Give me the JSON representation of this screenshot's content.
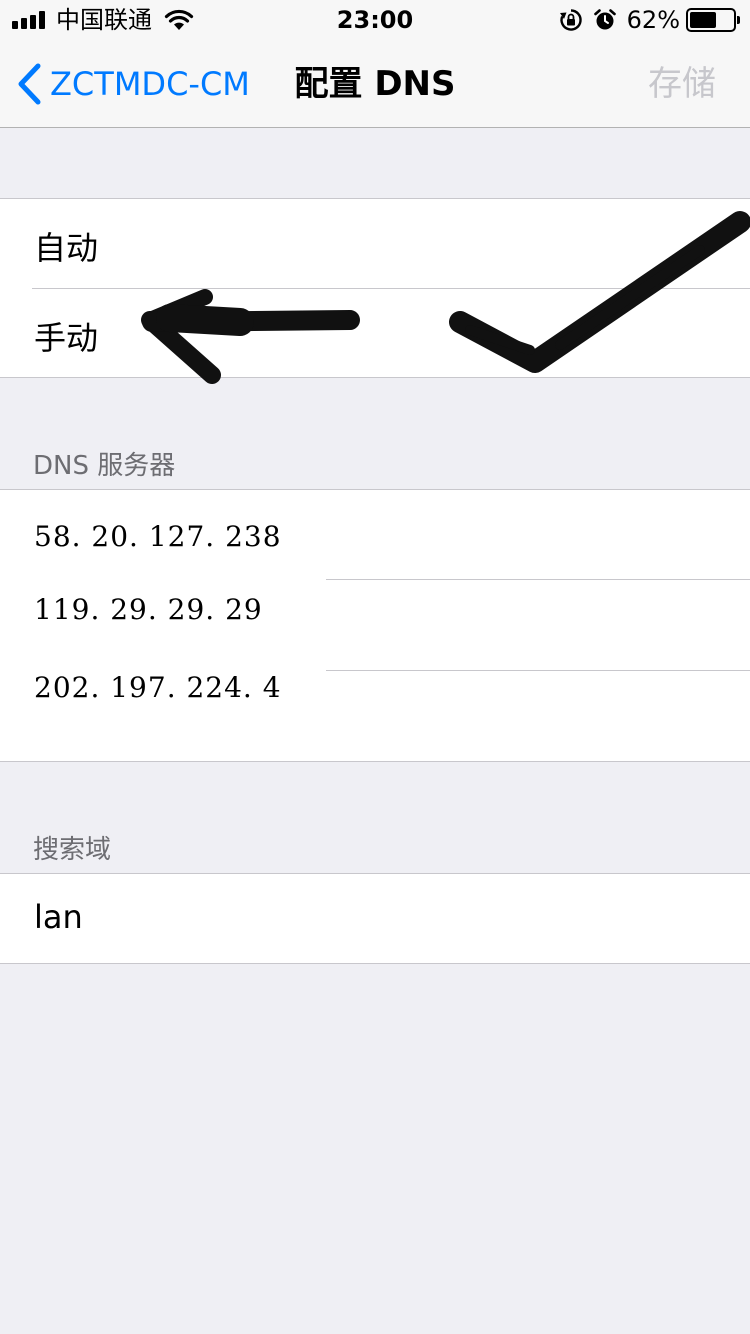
{
  "status_bar": {
    "carrier": "中国联通",
    "time": "23:00",
    "battery_percent": "62%",
    "battery_level": 0.62,
    "icons": [
      "signal-icon",
      "wifi-icon",
      "rotation-lock-icon",
      "alarm-icon",
      "battery-icon"
    ]
  },
  "nav": {
    "back_label": "ZCTMDC-CM",
    "title": "配置 DNS",
    "save_label": "存储"
  },
  "config": {
    "options": [
      {
        "label": "自动"
      },
      {
        "label": "手动"
      }
    ]
  },
  "dns": {
    "header": "DNS 服务器",
    "servers": [
      "58. 20. 127. 238",
      "119. 29. 29. 29",
      "202. 197. 224. 4"
    ]
  },
  "search_domains": {
    "header": "搜索域",
    "items": [
      "lan"
    ]
  },
  "colors": {
    "accent": "#007aff",
    "background": "#efeff4",
    "disabled": "#c7c7cc",
    "annotation": "#111111"
  }
}
